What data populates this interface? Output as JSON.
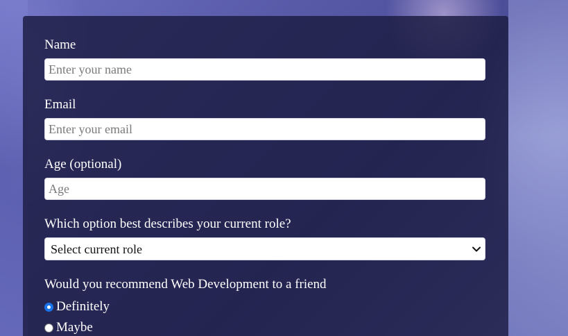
{
  "form": {
    "name": {
      "label": "Name",
      "placeholder": "Enter your name",
      "value": ""
    },
    "email": {
      "label": "Email",
      "placeholder": "Enter your email",
      "value": ""
    },
    "age": {
      "label": "Age (optional)",
      "placeholder": "Age",
      "value": ""
    },
    "role": {
      "label": "Which option best describes your current role?",
      "selected": "Select current role"
    },
    "recommend": {
      "question": "Would you recommend Web Development to a friend",
      "options": [
        {
          "label": "Definitely",
          "checked": true
        },
        {
          "label": "Maybe",
          "checked": false
        }
      ]
    }
  },
  "colors": {
    "card_background": "#1e1e46",
    "radio_accent": "#1a73e8",
    "label_text": "#ffffff"
  },
  "icons": {
    "select_arrow": "chevron-down-icon"
  }
}
